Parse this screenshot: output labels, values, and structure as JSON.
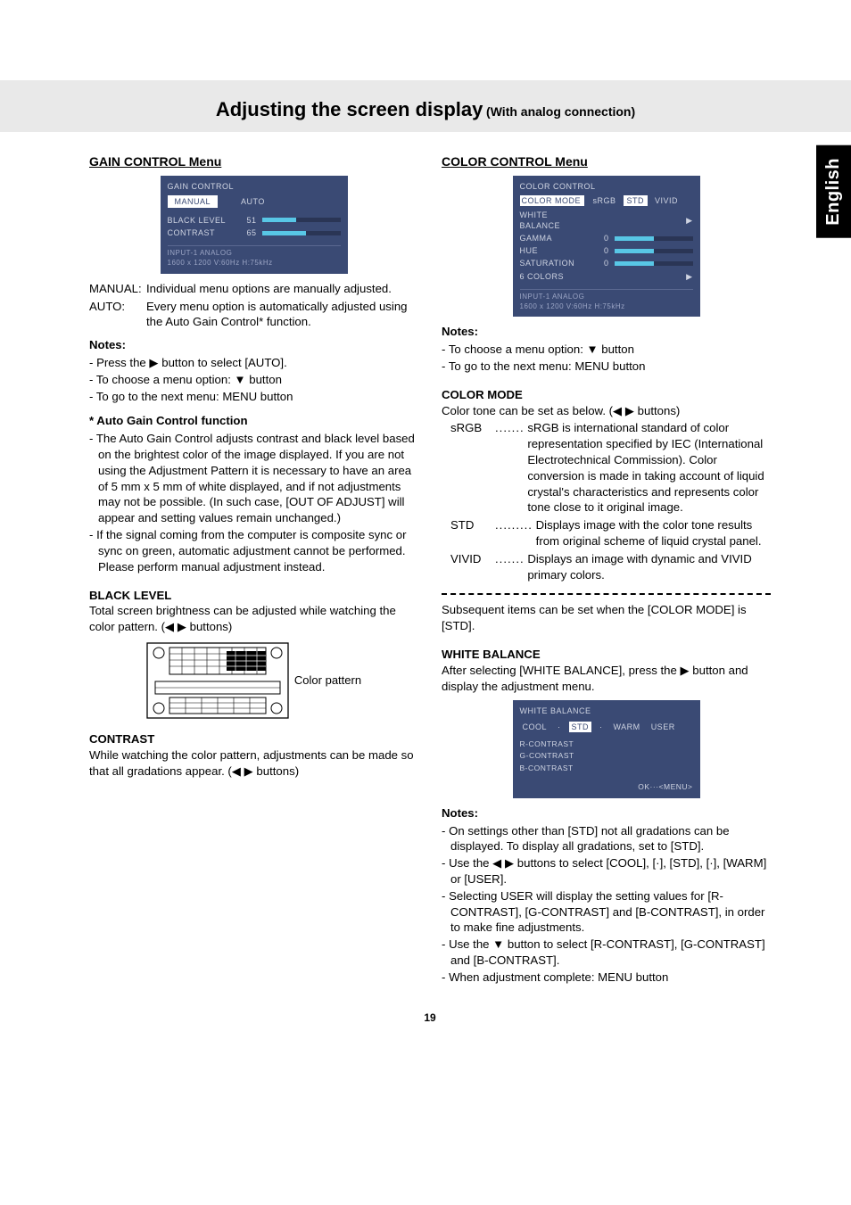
{
  "sideTab": "English",
  "header": {
    "title": "Adjusting the screen display",
    "sub": "(With analog connection)"
  },
  "gain": {
    "menuTitle": "GAIN CONTROL Menu",
    "osd": {
      "title": "GAIN CONTROL",
      "tabs": [
        "MANUAL",
        "AUTO"
      ],
      "rows": [
        {
          "label": "BLACK LEVEL",
          "value": "51",
          "fillPct": 44
        },
        {
          "label": "CONTRAST",
          "value": "65",
          "fillPct": 56
        }
      ],
      "foot1": "INPUT-1    ANALOG",
      "foot2": "1600 x 1200      V:60Hz      H:75kHz"
    },
    "defs": [
      {
        "term": "MANUAL:",
        "def": "Individual menu options are manually adjusted."
      },
      {
        "term": "AUTO:",
        "def": "Every menu option is automatically adjusted using the Auto Gain Control* function."
      }
    ],
    "notesLabel": "Notes:",
    "notes": [
      "Press the ▶ button to select [AUTO].",
      "To choose a menu option: ▼ button",
      "To go to the next menu: MENU button"
    ],
    "starHead": "*  Auto Gain Control function",
    "starNotes": [
      "The Auto Gain Control adjusts contrast and black level based on the brightest color of the image displayed. If you are not using the Adjustment Pattern it is necessary to have an area of 5 mm x 5 mm of white displayed, and if not adjustments may not be possible. (In such case, [OUT OF ADJUST] will appear and setting values remain unchanged.)",
      "If the signal coming from the computer is composite sync or sync on green, automatic adjustment cannot be performed. Please perform manual adjustment instead."
    ],
    "blackLevelHead": "BLACK LEVEL",
    "blackLevelBody": "Total screen brightness can be adjusted while watching the color pattern. (◀ ▶ buttons)",
    "colorPatternLabel": "Color pattern",
    "contrastHead": "CONTRAST",
    "contrastBody": "While watching the color pattern, adjustments can be made so that all gradations appear. (◀ ▶ buttons)"
  },
  "color": {
    "menuTitle": "COLOR CONTROL Menu",
    "osd": {
      "title": "COLOR CONTROL",
      "topRow": {
        "label": "COLOR MODE",
        "modes": [
          "sRGB",
          "STD",
          "VIVID"
        ],
        "selected": "STD"
      },
      "items": [
        {
          "label": "WHITE BALANCE",
          "arrow": true
        },
        {
          "label": "GAMMA",
          "value": "0",
          "fillPct": 50
        },
        {
          "label": "HUE",
          "value": "0",
          "fillPct": 50
        },
        {
          "label": "SATURATION",
          "value": "0",
          "fillPct": 50
        },
        {
          "label": "6 COLORS",
          "arrow": true
        }
      ],
      "foot1": "INPUT-1    ANALOG",
      "foot2": "1600 x 1200      V:60Hz      H:75kHz"
    },
    "notesLabel": "Notes:",
    "notes": [
      "To choose a menu option: ▼ button",
      "To go to the next menu: MENU button"
    ],
    "colorModeHead": "COLOR MODE",
    "colorModeIntro": "Color tone can be set as below. (◀ ▶ buttons)",
    "modeList": [
      {
        "term": "sRGB",
        "dots": ".......",
        "def": "sRGB is international standard of color representation specified by IEC (International Electrotechnical Commission). Color conversion is made in taking account of liquid crystal's characteristics and represents color tone close to it original image."
      },
      {
        "term": "STD",
        "dots": ".........",
        "def": "Displays image with the color tone results from original scheme of liquid crystal panel."
      },
      {
        "term": "VIVID",
        "dots": ".......",
        "def": "Displays an image with dynamic and VIVID primary colors."
      }
    ],
    "afterHr": "Subsequent items can be set when the [COLOR MODE] is [STD].",
    "wbHead": "WHITE BALANCE",
    "wbBody": "After selecting [WHITE BALANCE], press the ▶ button and display the adjustment menu.",
    "wbOsd": {
      "title": "WHITE BALANCE",
      "opts": [
        "COOL",
        "·",
        "STD",
        "·",
        "WARM",
        "USER"
      ],
      "selected": "STD",
      "items": [
        "R-CONTRAST",
        "G-CONTRAST",
        "B-CONTRAST"
      ],
      "ok": "OK···<MENU>"
    },
    "wbNotesLabel": "Notes:",
    "wbNotes": [
      "On settings other than [STD] not all gradations can be displayed. To display all gradations, set to [STD].",
      "Use the ◀ ▶ buttons to select [COOL], [·], [STD], [·], [WARM] or [USER].",
      "Selecting USER will display the setting values for [R-CONTRAST], [G-CONTRAST] and [B-CONTRAST], in order to make fine adjustments.",
      "Use the ▼ button to select [R-CONTRAST], [G-CONTRAST] and [B-CONTRAST].",
      "When adjustment complete: MENU button"
    ]
  },
  "pageNumber": "19"
}
